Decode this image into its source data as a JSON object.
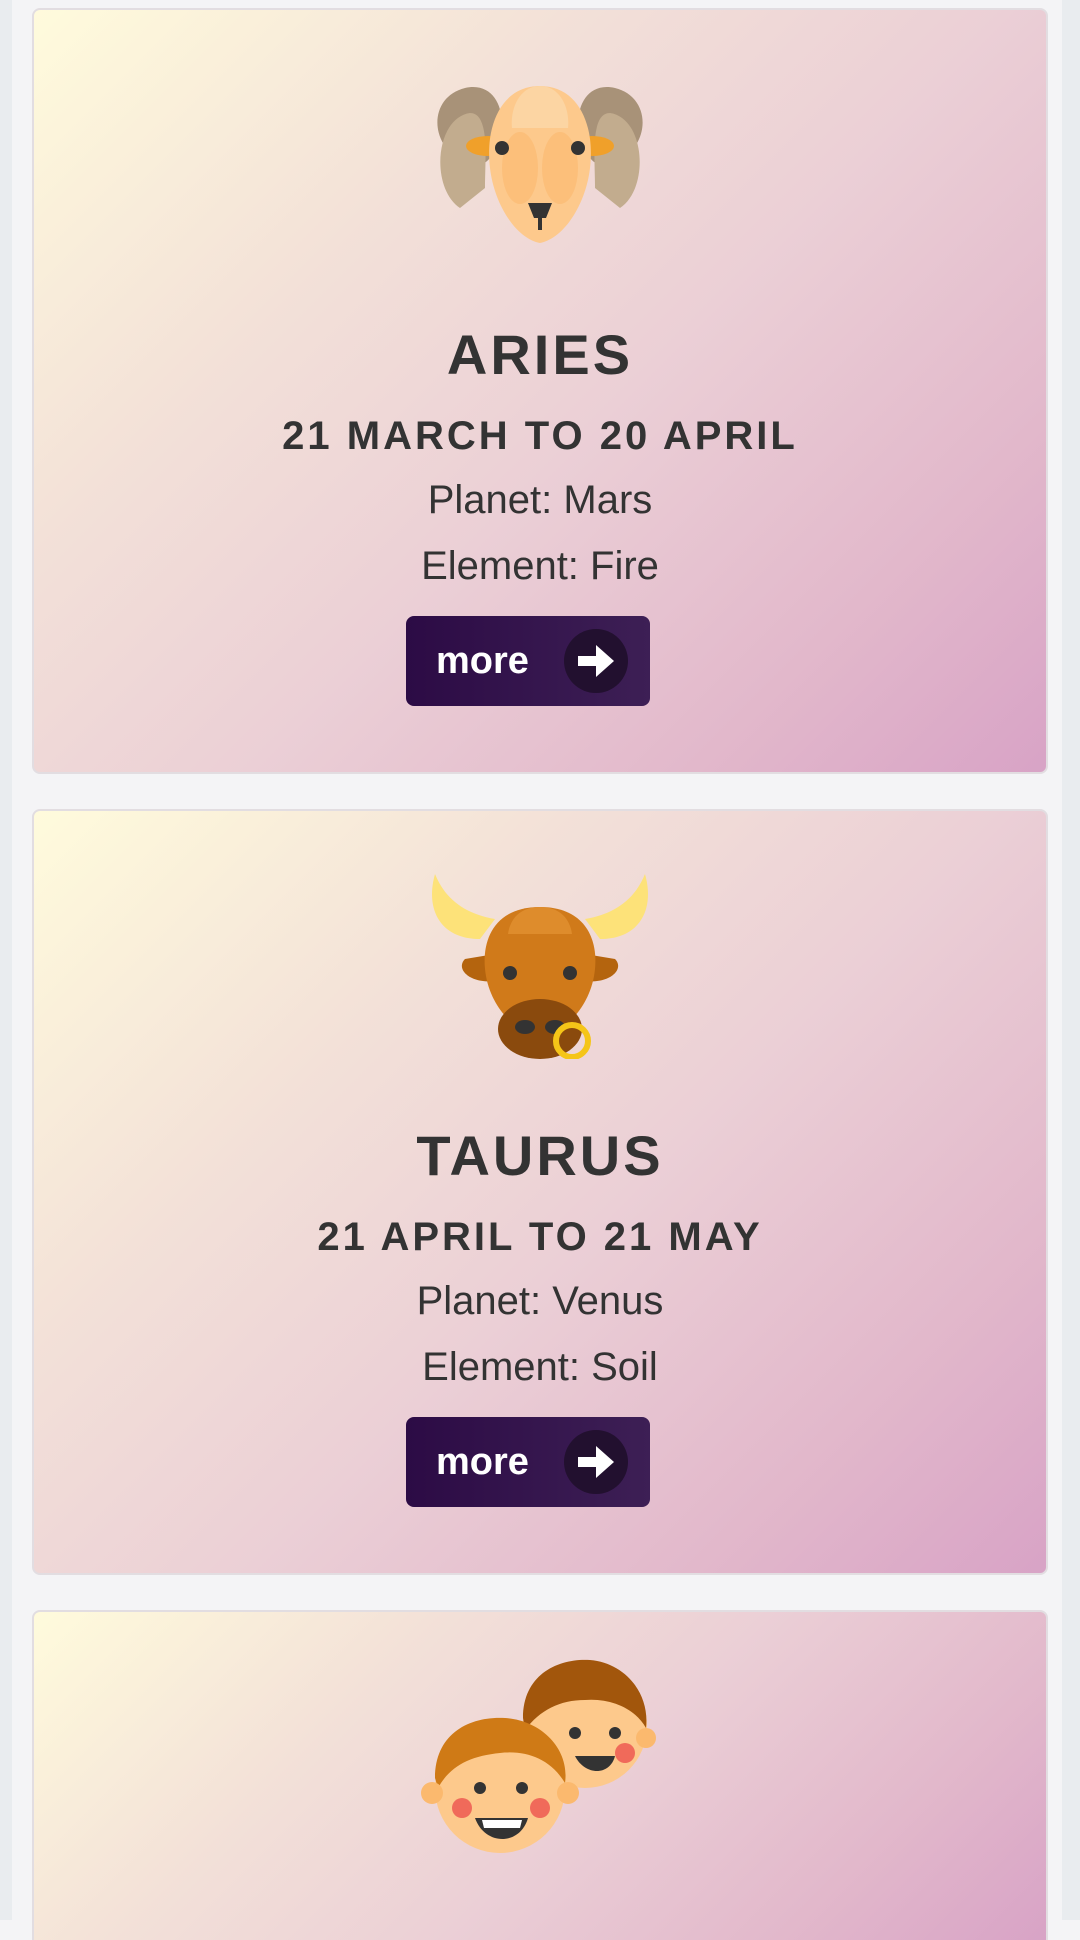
{
  "cards": [
    {
      "icon": "ram-icon",
      "title": "ARIES",
      "dates": "21 MARCH TO 20 APRIL",
      "planet": "Planet: Mars",
      "element": "Element: Fire",
      "button_label": "more"
    },
    {
      "icon": "bull-icon",
      "title": "TAURUS",
      "dates": "21 APRIL TO 21 MAY",
      "planet": "Planet: Venus",
      "element": "Element: Soil",
      "button_label": "more"
    },
    {
      "icon": "twins-icon"
    }
  ],
  "colors": {
    "button_bg": "#2c0b45",
    "text": "#333333"
  }
}
